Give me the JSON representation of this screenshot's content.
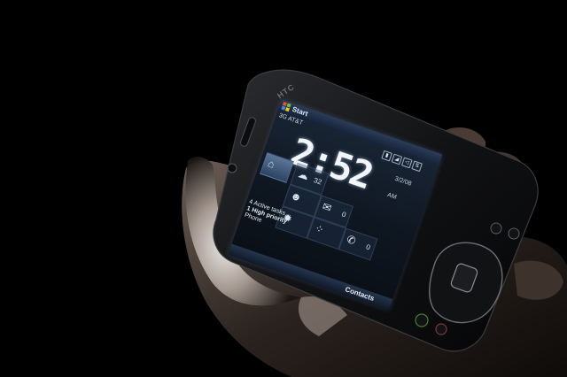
{
  "device": {
    "brand": "HTC"
  },
  "screen": {
    "start_label": "Start",
    "carrier": "3G AT&T",
    "time": "2:52",
    "ampm": "AM",
    "date": "3/2/08",
    "weather_count": "32",
    "messages_count": "0",
    "missed_calls_count": "0",
    "tasks_line1": "4 Active tasks",
    "tasks_line2": "1 High priority",
    "tasks_line3": "Phone",
    "softkey_right": "Contacts"
  },
  "colors": {
    "background": "#000000",
    "screen_glow": "#9fc0ff"
  }
}
